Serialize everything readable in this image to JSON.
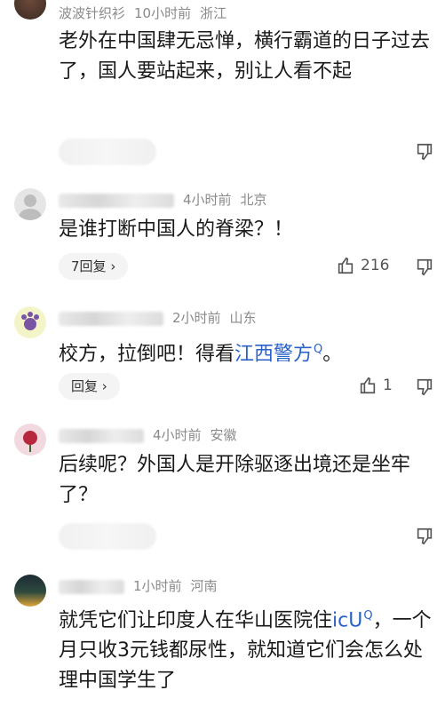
{
  "comments": [
    {
      "username": "波波针织衫",
      "time": "10小时前",
      "location": "浙江",
      "text": "老外在中国肆无忌惮，横行霸道的日子过去了，国人要站起来，别让人看不起",
      "like_count": "",
      "reply_label": ""
    },
    {
      "username": "",
      "time": "4小时前",
      "location": "北京",
      "text": "是谁打断中国人的脊梁？！",
      "like_count": "216",
      "reply_label": "7回复"
    },
    {
      "username": "",
      "time": "2小时前",
      "location": "山东",
      "text_before": "校方，拉倒吧！得看",
      "link_text": "江西警方",
      "text_after": "。",
      "like_count": "1",
      "reply_label": "回复"
    },
    {
      "username": "",
      "time": "4小时前",
      "location": "安徽",
      "text": "后续呢？外国人是开除驱逐出境还是坐牢了？",
      "like_count": "",
      "reply_label": ""
    },
    {
      "username": "",
      "time": "1小时前",
      "location": "河南",
      "text_before": "就凭它们让印度人在华山医院住",
      "link_text": "icU",
      "text_after": "，一个月只收3元钱都尿性，就知道它们会怎么处理中国学生了",
      "like_count": "",
      "reply_label": ""
    }
  ],
  "icons": {
    "chevron": "›",
    "search_superscript": "Q"
  },
  "colors": {
    "link": "#2a62c9",
    "meta": "#8a8a8a",
    "pill_bg": "#f4f4f4"
  }
}
